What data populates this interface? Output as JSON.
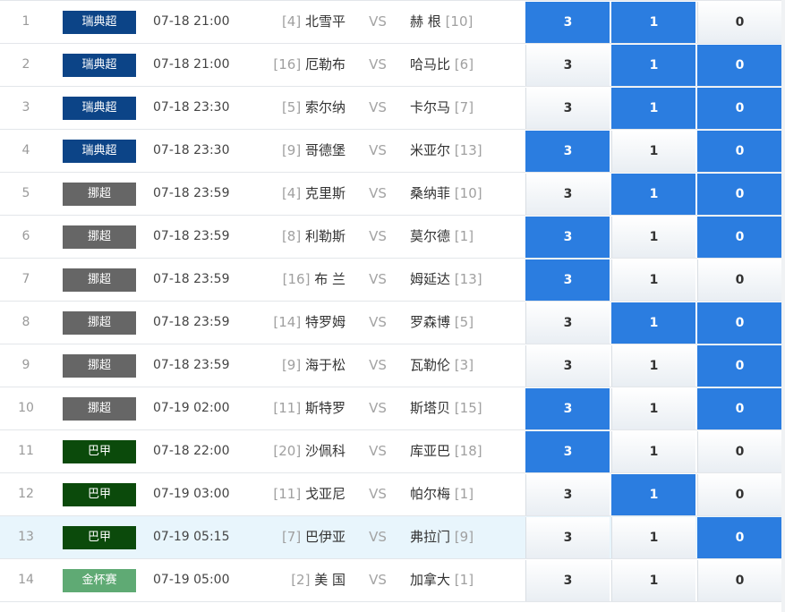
{
  "colors": {
    "league": {
      "瑞典超": "#0c4487",
      "挪超": "#666666",
      "巴甲": "#0b4a0b",
      "金杯赛": "#5faa74"
    },
    "selected": "#2b7de0"
  },
  "matches": [
    {
      "index": "1",
      "league": "瑞典超",
      "time": "07-18 21:00",
      "home_rank": "[4]",
      "home": "北雪平",
      "vs": "VS",
      "away": "赫 根",
      "away_rank": "[10]",
      "options": [
        "3",
        "1",
        "0"
      ],
      "selected": [
        0,
        1
      ]
    },
    {
      "index": "2",
      "league": "瑞典超",
      "time": "07-18 21:00",
      "home_rank": "[16]",
      "home": "厄勒布",
      "vs": "VS",
      "away": "哈马比",
      "away_rank": "[6]",
      "options": [
        "3",
        "1",
        "0"
      ],
      "selected": [
        1,
        2
      ]
    },
    {
      "index": "3",
      "league": "瑞典超",
      "time": "07-18 23:30",
      "home_rank": "[5]",
      "home": "索尔纳",
      "vs": "VS",
      "away": "卡尔马",
      "away_rank": "[7]",
      "options": [
        "3",
        "1",
        "0"
      ],
      "selected": [
        1,
        2
      ]
    },
    {
      "index": "4",
      "league": "瑞典超",
      "time": "07-18 23:30",
      "home_rank": "[9]",
      "home": "哥德堡",
      "vs": "VS",
      "away": "米亚尔",
      "away_rank": "[13]",
      "options": [
        "3",
        "1",
        "0"
      ],
      "selected": [
        0,
        2
      ]
    },
    {
      "index": "5",
      "league": "挪超",
      "time": "07-18 23:59",
      "home_rank": "[4]",
      "home": "克里斯",
      "vs": "VS",
      "away": "桑纳菲",
      "away_rank": "[10]",
      "options": [
        "3",
        "1",
        "0"
      ],
      "selected": [
        1,
        2
      ]
    },
    {
      "index": "6",
      "league": "挪超",
      "time": "07-18 23:59",
      "home_rank": "[8]",
      "home": "利勒斯",
      "vs": "VS",
      "away": "莫尔德",
      "away_rank": "[1]",
      "options": [
        "3",
        "1",
        "0"
      ],
      "selected": [
        0,
        2
      ]
    },
    {
      "index": "7",
      "league": "挪超",
      "time": "07-18 23:59",
      "home_rank": "[16]",
      "home": "布 兰",
      "vs": "VS",
      "away": "姆延达",
      "away_rank": "[13]",
      "options": [
        "3",
        "1",
        "0"
      ],
      "selected": [
        0
      ]
    },
    {
      "index": "8",
      "league": "挪超",
      "time": "07-18 23:59",
      "home_rank": "[14]",
      "home": "特罗姆",
      "vs": "VS",
      "away": "罗森博",
      "away_rank": "[5]",
      "options": [
        "3",
        "1",
        "0"
      ],
      "selected": [
        1,
        2
      ]
    },
    {
      "index": "9",
      "league": "挪超",
      "time": "07-18 23:59",
      "home_rank": "[9]",
      "home": "海于松",
      "vs": "VS",
      "away": "瓦勒伦",
      "away_rank": "[3]",
      "options": [
        "3",
        "1",
        "0"
      ],
      "selected": [
        2
      ]
    },
    {
      "index": "10",
      "league": "挪超",
      "time": "07-19 02:00",
      "home_rank": "[11]",
      "home": "斯特罗",
      "vs": "VS",
      "away": "斯塔贝",
      "away_rank": "[15]",
      "options": [
        "3",
        "1",
        "0"
      ],
      "selected": [
        0,
        2
      ]
    },
    {
      "index": "11",
      "league": "巴甲",
      "time": "07-18 22:00",
      "home_rank": "[20]",
      "home": "沙佩科",
      "vs": "VS",
      "away": "库亚巴",
      "away_rank": "[18]",
      "options": [
        "3",
        "1",
        "0"
      ],
      "selected": [
        0
      ]
    },
    {
      "index": "12",
      "league": "巴甲",
      "time": "07-19 03:00",
      "home_rank": "[11]",
      "home": "戈亚尼",
      "vs": "VS",
      "away": "帕尔梅",
      "away_rank": "[1]",
      "options": [
        "3",
        "1",
        "0"
      ],
      "selected": [
        1
      ]
    },
    {
      "index": "13",
      "league": "巴甲",
      "time": "07-19 05:15",
      "home_rank": "[7]",
      "home": "巴伊亚",
      "vs": "VS",
      "away": "弗拉门",
      "away_rank": "[9]",
      "options": [
        "3",
        "1",
        "0"
      ],
      "selected": [
        2
      ],
      "highlighted": true
    },
    {
      "index": "14",
      "league": "金杯赛",
      "time": "07-19 05:00",
      "home_rank": "[2]",
      "home": "美 国",
      "vs": "VS",
      "away": "加拿大",
      "away_rank": "[1]",
      "options": [
        "3",
        "1",
        "0"
      ],
      "selected": []
    }
  ]
}
